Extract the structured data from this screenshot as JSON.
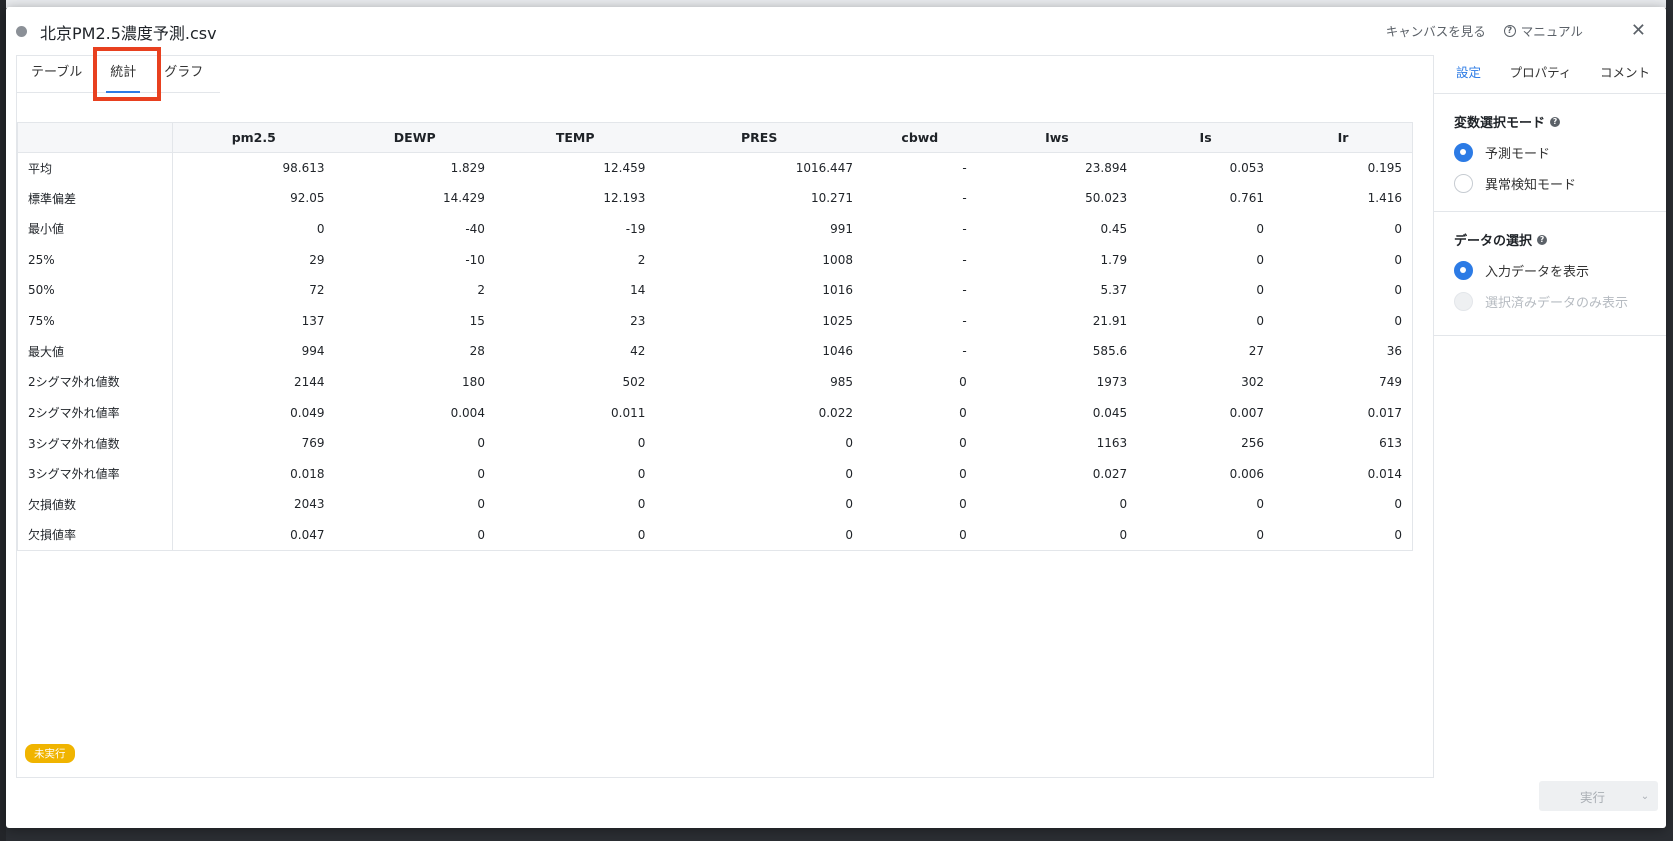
{
  "window": {
    "title": "北京PM2.5濃度予測.csv",
    "links": {
      "canvas": "キャンバスを見る",
      "manual": "マニュアル"
    }
  },
  "tabs": [
    {
      "label": "テーブル",
      "active": false
    },
    {
      "label": "統計",
      "active": true
    },
    {
      "label": "グラフ",
      "active": false
    }
  ],
  "table": {
    "columns": [
      "pm2.5",
      "DEWP",
      "TEMP",
      "PRES",
      "cbwd",
      "Iws",
      "Is",
      "Ir"
    ],
    "rows": [
      {
        "label": "平均",
        "values": [
          "98.613",
          "1.829",
          "12.459",
          "1016.447",
          "-",
          "23.894",
          "0.053",
          "0.195"
        ]
      },
      {
        "label": "標準偏差",
        "values": [
          "92.05",
          "14.429",
          "12.193",
          "10.271",
          "-",
          "50.023",
          "0.761",
          "1.416"
        ]
      },
      {
        "label": "最小値",
        "values": [
          "0",
          "-40",
          "-19",
          "991",
          "-",
          "0.45",
          "0",
          "0"
        ]
      },
      {
        "label": "25%",
        "values": [
          "29",
          "-10",
          "2",
          "1008",
          "-",
          "1.79",
          "0",
          "0"
        ]
      },
      {
        "label": "50%",
        "values": [
          "72",
          "2",
          "14",
          "1016",
          "-",
          "5.37",
          "0",
          "0"
        ]
      },
      {
        "label": "75%",
        "values": [
          "137",
          "15",
          "23",
          "1025",
          "-",
          "21.91",
          "0",
          "0"
        ]
      },
      {
        "label": "最大値",
        "values": [
          "994",
          "28",
          "42",
          "1046",
          "-",
          "585.6",
          "27",
          "36"
        ]
      },
      {
        "label": "2シグマ外れ値数",
        "values": [
          "2144",
          "180",
          "502",
          "985",
          "0",
          "1973",
          "302",
          "749"
        ]
      },
      {
        "label": "2シグマ外れ値率",
        "values": [
          "0.049",
          "0.004",
          "0.011",
          "0.022",
          "0",
          "0.045",
          "0.007",
          "0.017"
        ]
      },
      {
        "label": "3シグマ外れ値数",
        "values": [
          "769",
          "0",
          "0",
          "0",
          "0",
          "1163",
          "256",
          "613"
        ]
      },
      {
        "label": "3シグマ外れ値率",
        "values": [
          "0.018",
          "0",
          "0",
          "0",
          "0",
          "0.027",
          "0.006",
          "0.014"
        ]
      },
      {
        "label": "欠損値数",
        "values": [
          "2043",
          "0",
          "0",
          "0",
          "0",
          "0",
          "0",
          "0"
        ]
      },
      {
        "label": "欠損値率",
        "values": [
          "0.047",
          "0",
          "0",
          "0",
          "0",
          "0",
          "0",
          "0"
        ]
      }
    ]
  },
  "side_panel": {
    "tabs": [
      {
        "label": "設定",
        "active": true
      },
      {
        "label": "プロパティ",
        "active": false
      },
      {
        "label": "コメント",
        "active": false
      }
    ],
    "variable_mode": {
      "title": "変数選択モード",
      "options": [
        {
          "label": "予測モード",
          "checked": true,
          "disabled": false
        },
        {
          "label": "異常検知モード",
          "checked": false,
          "disabled": false
        }
      ]
    },
    "data_selection": {
      "title": "データの選択",
      "options": [
        {
          "label": "入力データを表示",
          "checked": true,
          "disabled": false
        },
        {
          "label": "選択済みデータのみ表示",
          "checked": false,
          "disabled": true
        }
      ]
    }
  },
  "footer": {
    "status": "未実行",
    "run_label": "実行"
  },
  "colors": {
    "accent": "#2c7be5",
    "status_badge": "#f0b400",
    "highlight_box": "#e8401f"
  }
}
